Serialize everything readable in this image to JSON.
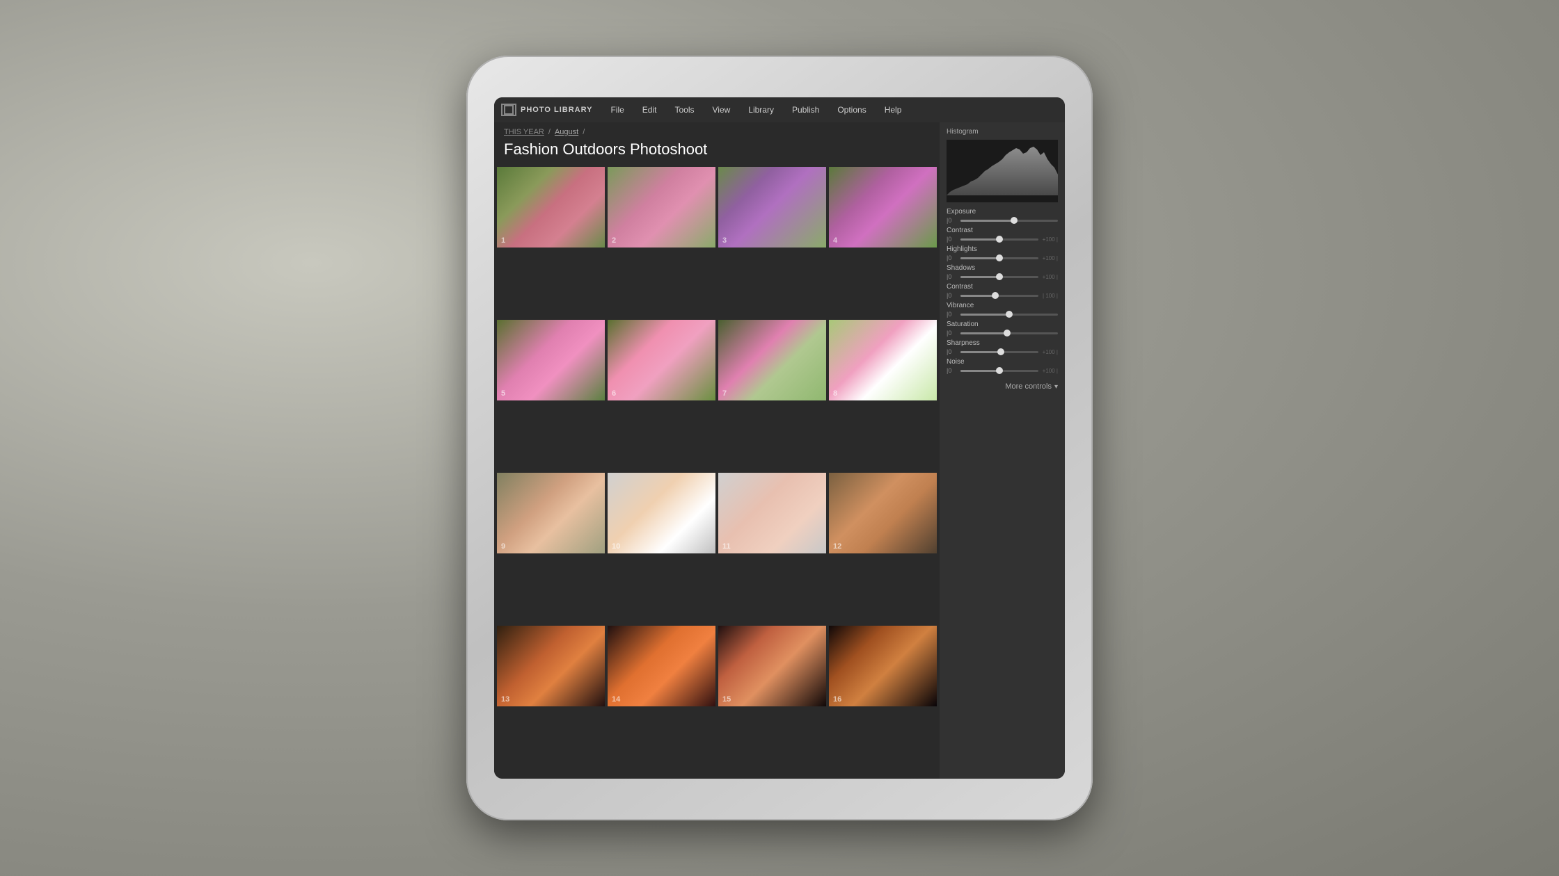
{
  "app": {
    "name": "PHOTO LIBRARY",
    "logo_alt": "film-strip-icon"
  },
  "menu": {
    "items": [
      "File",
      "Edit",
      "Tools",
      "View",
      "Library",
      "Publish",
      "Options",
      "Help"
    ]
  },
  "breadcrumb": {
    "parts": [
      {
        "label": "THIS YEAR",
        "type": "link"
      },
      {
        "label": "/",
        "type": "sep"
      },
      {
        "label": "August",
        "type": "link"
      },
      {
        "label": "/",
        "type": "sep"
      }
    ]
  },
  "page": {
    "title": "Fashion Outdoors Photoshoot"
  },
  "photos": [
    {
      "number": "1",
      "class": "photo-1"
    },
    {
      "number": "2",
      "class": "photo-2"
    },
    {
      "number": "3",
      "class": "photo-3"
    },
    {
      "number": "4",
      "class": "photo-4"
    },
    {
      "number": "5",
      "class": "photo-5"
    },
    {
      "number": "6",
      "class": "photo-6"
    },
    {
      "number": "7",
      "class": "photo-7"
    },
    {
      "number": "8",
      "class": "photo-8"
    },
    {
      "number": "9",
      "class": "photo-9"
    },
    {
      "number": "10",
      "class": "photo-10"
    },
    {
      "number": "11",
      "class": "photo-11"
    },
    {
      "number": "12",
      "class": "photo-12"
    },
    {
      "number": "13",
      "class": "photo-13"
    },
    {
      "number": "14",
      "class": "photo-14"
    },
    {
      "number": "15",
      "class": "photo-15"
    },
    {
      "number": "16",
      "class": "photo-16"
    }
  ],
  "histogram": {
    "label": "Histogram"
  },
  "adjustments": [
    {
      "label": "Exposure",
      "value": "0",
      "max": "",
      "pct": 55
    },
    {
      "label": "Contrast",
      "value": "0",
      "max": "+100 |",
      "pct": 50
    },
    {
      "label": "Highlights",
      "value": "0",
      "max": "+100 |",
      "pct": 50
    },
    {
      "label": "Shadows",
      "value": "0",
      "max": "+100 |",
      "pct": 50
    },
    {
      "label": "Contrast",
      "value": "0",
      "max": "| 100 |",
      "pct": 45
    },
    {
      "label": "Vibrance",
      "value": "0",
      "max": "",
      "pct": 50
    },
    {
      "label": "Saturation",
      "value": "0",
      "max": "",
      "pct": 48
    },
    {
      "label": "Sharpness",
      "value": "0",
      "max": "+100 |",
      "pct": 52
    },
    {
      "label": "Noise",
      "value": "0",
      "max": "+100 |",
      "pct": 50
    }
  ],
  "more_controls": {
    "label": "More controls"
  }
}
